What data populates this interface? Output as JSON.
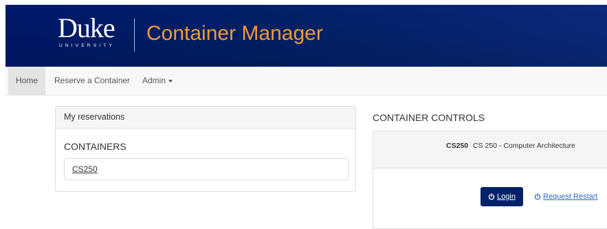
{
  "banner": {
    "logo_word": "Duke",
    "logo_sub": "UNIVERSITY",
    "app_title": "Container Manager",
    "bg_color": "#012169",
    "title_color": "#f09a3a"
  },
  "nav": {
    "home": "Home",
    "reserve": "Reserve a Container",
    "admin": "Admin"
  },
  "reservations": {
    "heading": "My reservations",
    "containers_title": "CONTAINERS",
    "items": [
      {
        "label": "CS250"
      }
    ]
  },
  "controls": {
    "title": "CONTAINER CONTROLS",
    "code": "CS250",
    "name": "CS 250 - Computer Architecture",
    "login_label": "Login",
    "restart_label": "Request Restart",
    "icons": {
      "login": "power-icon",
      "restart": "power-icon"
    }
  }
}
